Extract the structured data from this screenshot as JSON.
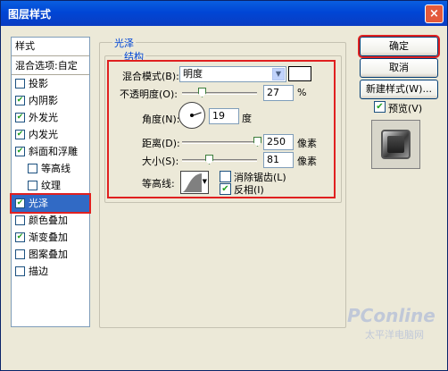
{
  "window": {
    "title": "图层样式",
    "close": "×"
  },
  "sidebar": {
    "header": "样式",
    "blend_options": "混合选项:自定",
    "items": [
      {
        "label": "投影",
        "checked": false
      },
      {
        "label": "内阴影",
        "checked": true
      },
      {
        "label": "外发光",
        "checked": true
      },
      {
        "label": "内发光",
        "checked": true
      },
      {
        "label": "斜面和浮雕",
        "checked": true
      },
      {
        "label": "等高线",
        "checked": false
      },
      {
        "label": "纹理",
        "checked": false
      },
      {
        "label": "光泽",
        "checked": true
      },
      {
        "label": "颜色叠加",
        "checked": false
      },
      {
        "label": "渐变叠加",
        "checked": true
      },
      {
        "label": "图案叠加",
        "checked": false
      },
      {
        "label": "描边",
        "checked": false
      }
    ],
    "selected": "光泽"
  },
  "panel": {
    "group_title": "光泽",
    "subgroup_title": "结构",
    "blend_mode_label": "混合模式(B):",
    "blend_mode_value": "明度",
    "opacity_label": "不透明度(O):",
    "opacity_value": "27",
    "opacity_unit": "%",
    "angle_label": "角度(N):",
    "angle_value": "19",
    "angle_unit": "度",
    "distance_label": "距离(D):",
    "distance_value": "250",
    "distance_unit": "像素",
    "size_label": "大小(S):",
    "size_value": "81",
    "size_unit": "像素",
    "contour_label": "等高线:",
    "antialias_label": "消除锯齿(L)",
    "antialias_checked": false,
    "invert_label": "反相(I)",
    "invert_checked": true
  },
  "buttons": {
    "ok": "确定",
    "cancel": "取消",
    "new_style": "新建样式(W)...",
    "preview_label": "预览(V)",
    "preview_checked": true
  },
  "watermark": {
    "brand": "PConline",
    "sub": "太平洋电脑网"
  },
  "colors": {
    "accent": "#e02020",
    "title_blue": "#0046d5",
    "selection": "#316ac5"
  }
}
